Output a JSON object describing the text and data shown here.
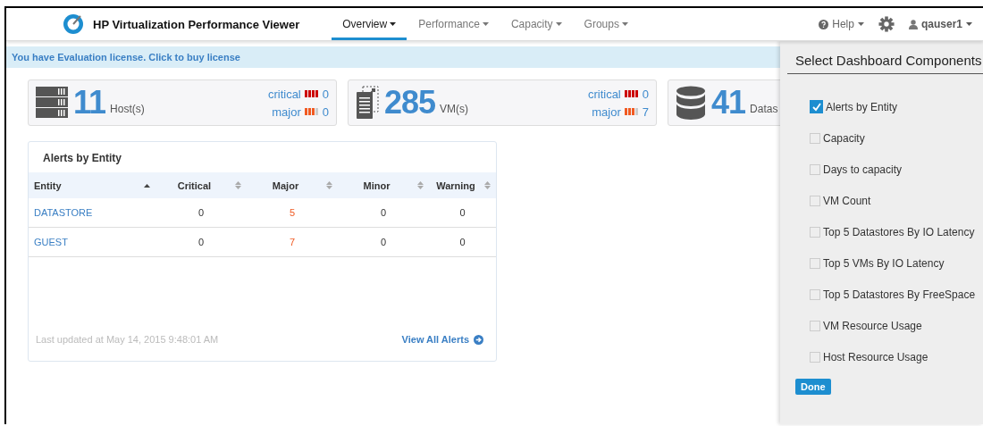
{
  "header": {
    "title": "HP Virtualization Performance Viewer",
    "nav": [
      {
        "label": "Overview",
        "selected": true
      },
      {
        "label": "Performance",
        "selected": false
      },
      {
        "label": "Capacity",
        "selected": false
      },
      {
        "label": "Groups",
        "selected": false
      }
    ],
    "help": "Help",
    "user": "qauser1"
  },
  "license": {
    "text": "You have Evaluation license. Click to buy license"
  },
  "stats": [
    {
      "kind": "host",
      "count": "11",
      "unit": "Host(s)",
      "alerts": [
        {
          "label": "critical",
          "kind": "critical",
          "value": "0"
        },
        {
          "label": "major",
          "kind": "major",
          "value": "0"
        }
      ]
    },
    {
      "kind": "vm",
      "count": "285",
      "unit": "VM(s)",
      "alerts": [
        {
          "label": "critical",
          "kind": "critical",
          "value": "0"
        },
        {
          "label": "major",
          "kind": "major",
          "value": "7"
        }
      ]
    },
    {
      "kind": "datastore",
      "count": "41",
      "unit": "Datas"
    }
  ],
  "alerts": {
    "title": "Alerts by Entity",
    "columns": [
      {
        "label": "Entity",
        "sorted": true
      },
      {
        "label": "Critical",
        "sorted": false
      },
      {
        "label": "Major",
        "sorted": false
      },
      {
        "label": "Minor",
        "sorted": false
      },
      {
        "label": "Warning",
        "sorted": false
      }
    ],
    "rows": [
      {
        "entity": "DATASTORE",
        "critical": "0",
        "major": "5",
        "minor": "0",
        "warning": "0"
      },
      {
        "entity": "GUEST",
        "critical": "0",
        "major": "7",
        "minor": "0",
        "warning": "0"
      }
    ],
    "updated": "Last updated at May 14, 2015 9:48:01 AM",
    "link": "View All Alerts"
  },
  "components": {
    "title": "Select Dashboard Components",
    "items": [
      {
        "label": "Alerts by Entity",
        "checked": true
      },
      {
        "label": "Capacity",
        "checked": false
      },
      {
        "label": "Days to capacity",
        "checked": false
      },
      {
        "label": "VM Count",
        "checked": false
      },
      {
        "label": "Top 5 Datastores By IO Latency",
        "checked": false
      },
      {
        "label": "Top 5 VMs By IO Latency",
        "checked": false
      },
      {
        "label": "Top 5 Datastores By FreeSpace",
        "checked": false
      },
      {
        "label": "VM Resource Usage",
        "checked": false
      },
      {
        "label": "Host Resource Usage",
        "checked": false
      }
    ],
    "done": "Done"
  }
}
